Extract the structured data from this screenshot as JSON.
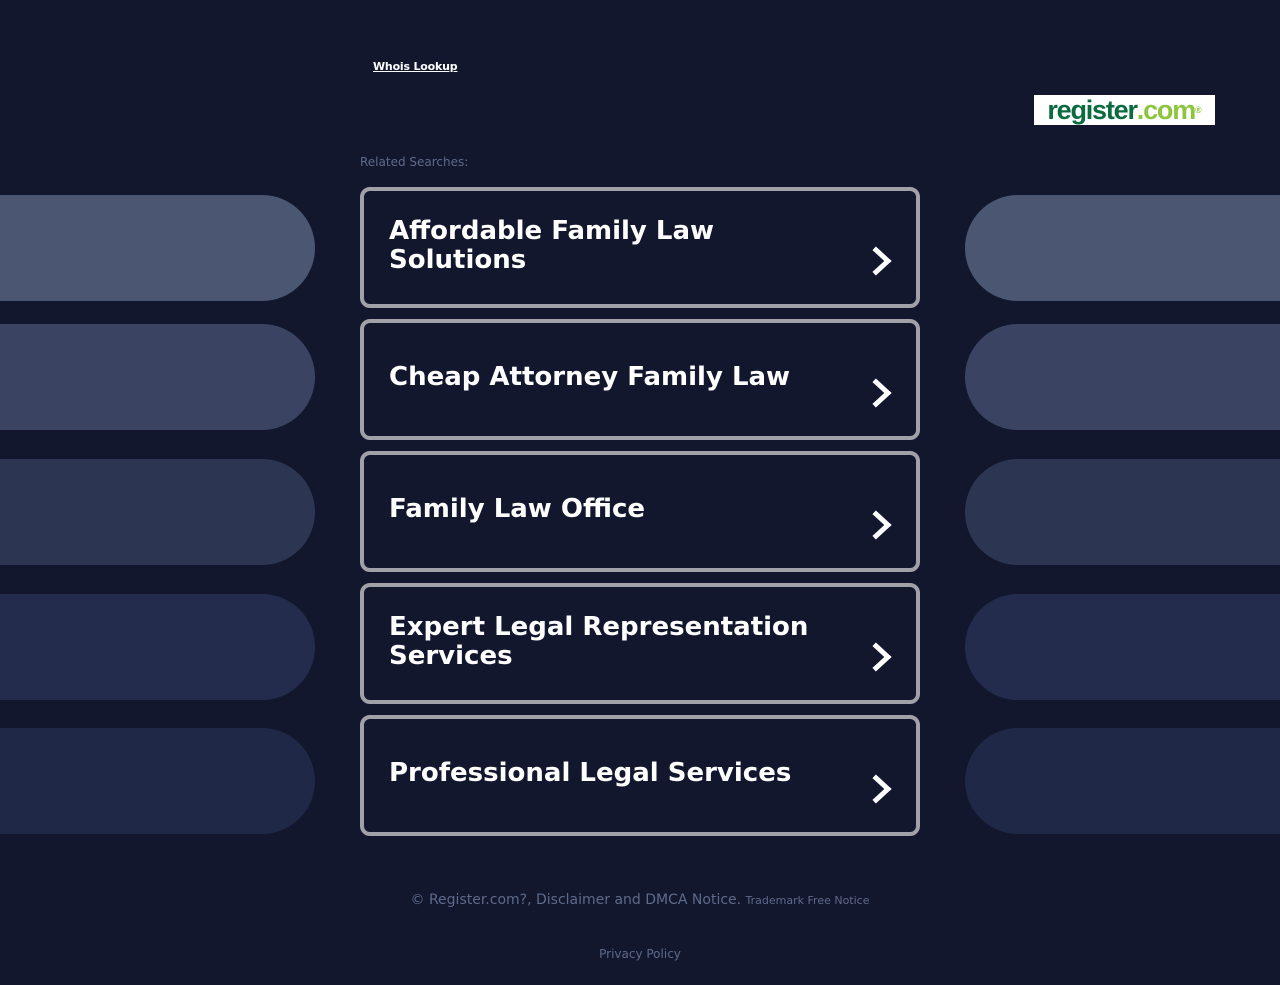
{
  "header": {
    "whois_label": "Whois Lookup",
    "logo": {
      "part1": "register",
      "part2": ".com",
      "mark": "®",
      "colors": {
        "primary": "#0b6b3f",
        "accent": "#8cc63f"
      }
    }
  },
  "related": {
    "label": "Related Searches:",
    "items": [
      {
        "label": "Affordable Family Law Solutions"
      },
      {
        "label": "Cheap Attorney Family Law"
      },
      {
        "label": "Family Law Office"
      },
      {
        "label": "Expert Legal Representation Services"
      },
      {
        "label": "Professional Legal Services"
      }
    ],
    "chevron_icon": "chevron-right-icon"
  },
  "footer": {
    "copyright": "© Register.com?, Disclaimer and DMCA Notice.",
    "trademark": "Trademark Free Notice",
    "privacy": "Privacy Policy"
  },
  "colors": {
    "background": "#12172d",
    "card_border": "#a0a0a6",
    "muted_text": "#5d6a8a",
    "pill_colors": [
      "#4b5672",
      "#3a4462",
      "#2c3552",
      "#232c4d",
      "#1f2847"
    ]
  }
}
